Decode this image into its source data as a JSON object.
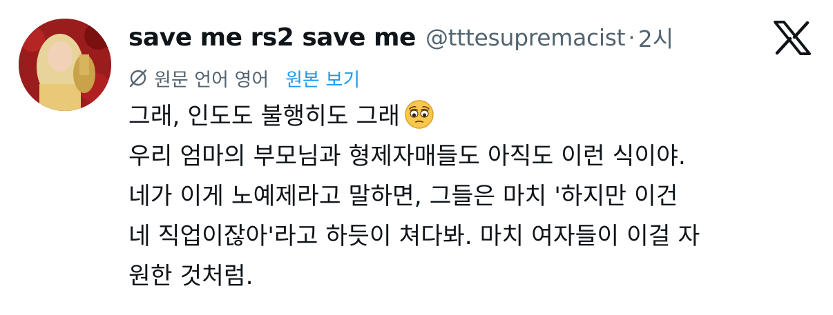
{
  "author": {
    "display_name": "save me rs2 save me",
    "handle": "@tttesupremacist",
    "separator": "·",
    "time": "2시",
    "avatar_icon": "user-avatar"
  },
  "platform": {
    "logo_icon": "x-logo-icon"
  },
  "translation": {
    "icon": "translate-icon",
    "note": "원문 언어 영어",
    "show_original_label": "원본 보기",
    "link_color": "#1d9bf0"
  },
  "tweet": {
    "lines": [
      "그래, 인도도 불행히도 그래",
      "우리 엄마의 부모님과 형제자매들도 아직도 이런 식이야.",
      "네가 이게 노예제라고 말하면, 그들은 마치 '하지만 이건",
      "네 직업이잖아'라고 하듯이 쳐다봐. 마치 여자들이 이걸 자",
      "원한 것처럼."
    ],
    "emoji": "pleading-face-emoji"
  },
  "colors": {
    "text_primary": "#0f1419",
    "text_secondary": "#536471",
    "accent": "#1d9bf0"
  }
}
